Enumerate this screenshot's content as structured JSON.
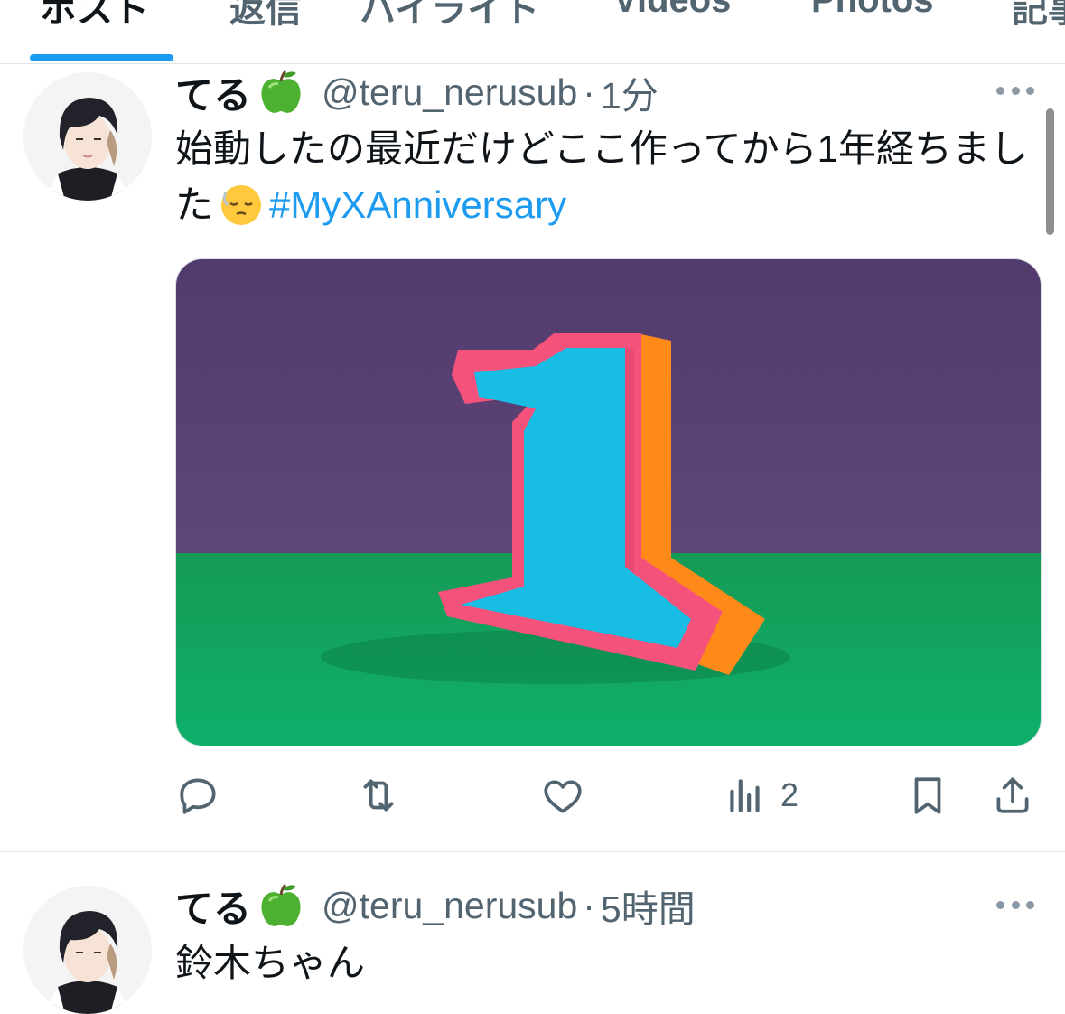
{
  "tabs": [
    {
      "label": "ポスト",
      "active": true
    },
    {
      "label": "返信",
      "active": false
    },
    {
      "label": "ハイライト",
      "active": false
    },
    {
      "label": "Videos",
      "active": false
    },
    {
      "label": "Photos",
      "active": false
    },
    {
      "label": "記事",
      "active": false
    }
  ],
  "tweets": [
    {
      "display_name": "てる",
      "name_emoji": "green-apple-icon",
      "handle": "@teru_nerusub",
      "separator": "·",
      "time": "1分",
      "text_main": "始動したの最近だけどここ作ってから1年経ちました",
      "text_emoji": "relieved-face-emoji",
      "hashtag": "#MyXAnniversary",
      "media": "anniversary-number-one-image",
      "views": "2"
    },
    {
      "display_name": "てる",
      "name_emoji": "green-apple-icon",
      "handle": "@teru_nerusub",
      "separator": "·",
      "time": "5時間",
      "text_main": "鈴木ちゃん"
    }
  ],
  "colors": {
    "accent": "#1d9bf0",
    "text_primary": "#0f1419",
    "text_secondary": "#536471",
    "divider": "#e1e4e7",
    "media_wall": "#573f72",
    "media_floor": "#1a9a5c",
    "number_face": "#18bde4",
    "number_rim": "#f4527a",
    "number_side": "#ff8a1a"
  }
}
